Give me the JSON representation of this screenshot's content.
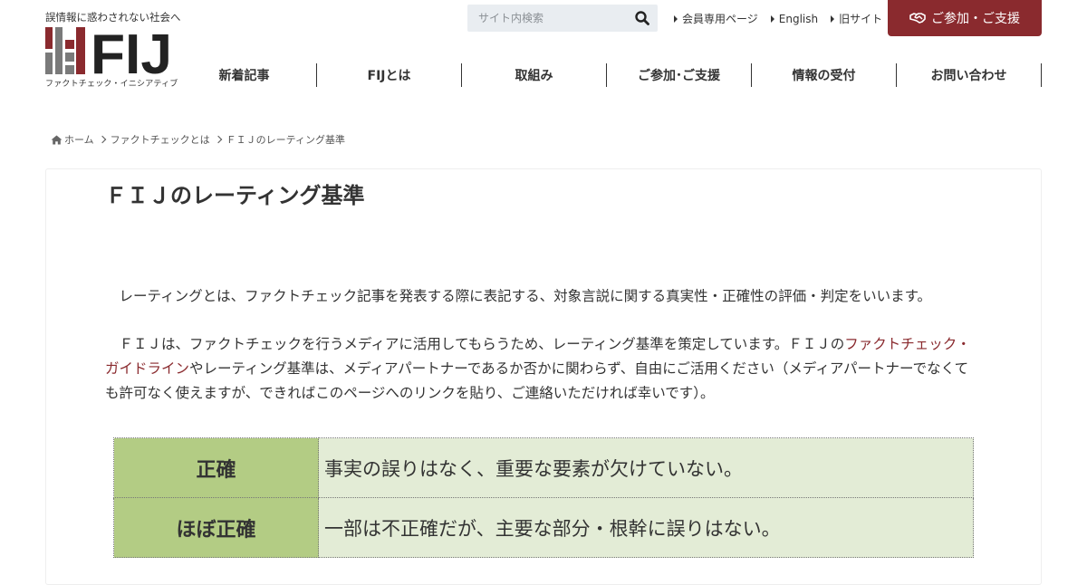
{
  "header": {
    "tagline": "誤情報に惑わされない社会へ",
    "logo_text": "FIJ",
    "logo_subtitle": "ファクトチェック・イニシアティブ",
    "search": {
      "placeholder": "サイト内検索",
      "value": ""
    },
    "top_links": [
      {
        "label": "会員専用ページ"
      },
      {
        "label": "English"
      },
      {
        "label": "旧サイト"
      }
    ],
    "join_button": "ご参加・ご支援",
    "nav": [
      {
        "label": "新着記事"
      },
      {
        "label": "FIJとは"
      },
      {
        "label": "取組み"
      },
      {
        "label": "ご参加･ご支援"
      },
      {
        "label": "情報の受付"
      },
      {
        "label": "お問い合わせ"
      }
    ]
  },
  "breadcrumb": {
    "home": "ホーム",
    "parent": "ファクトチェックとは",
    "current": "ＦＩＪのレーティング基準"
  },
  "article": {
    "title": "ＦＩＪのレーティング基準",
    "para1": "レーティングとは、ファクトチェック記事を発表する際に表記する、対象言説に関する真実性・正確性の評価・判定をいいます。",
    "para2_before": "ＦＩＪは、ファクトチェックを行うメディアに活用してもらうため、レーティング基準を策定しています。ＦＩＪの",
    "para2_link": "ファクトチェック・ガイドライン",
    "para2_after": "やレーティング基準は、メディアパートナーであるか否かに関わらず、自由にご活用ください（メディアパートナーでなくても許可なく使えますが、できればこのページへのリンクを貼り、ご連絡いただければ幸いです）。",
    "ratings": [
      {
        "label": "正確",
        "description": "事実の誤りはなく、重要な要素が欠けていない。"
      },
      {
        "label": "ほぼ正確",
        "description": "一部は不正確だが、主要な部分・根幹に誤りはない。"
      }
    ]
  },
  "colors": {
    "brand": "#8a2a2e",
    "logo_gray": "#7a7a7a",
    "rating_label_bg": "#b3cc84",
    "rating_desc_bg": "#e3ecd6",
    "search_bg": "#e9edf1"
  }
}
